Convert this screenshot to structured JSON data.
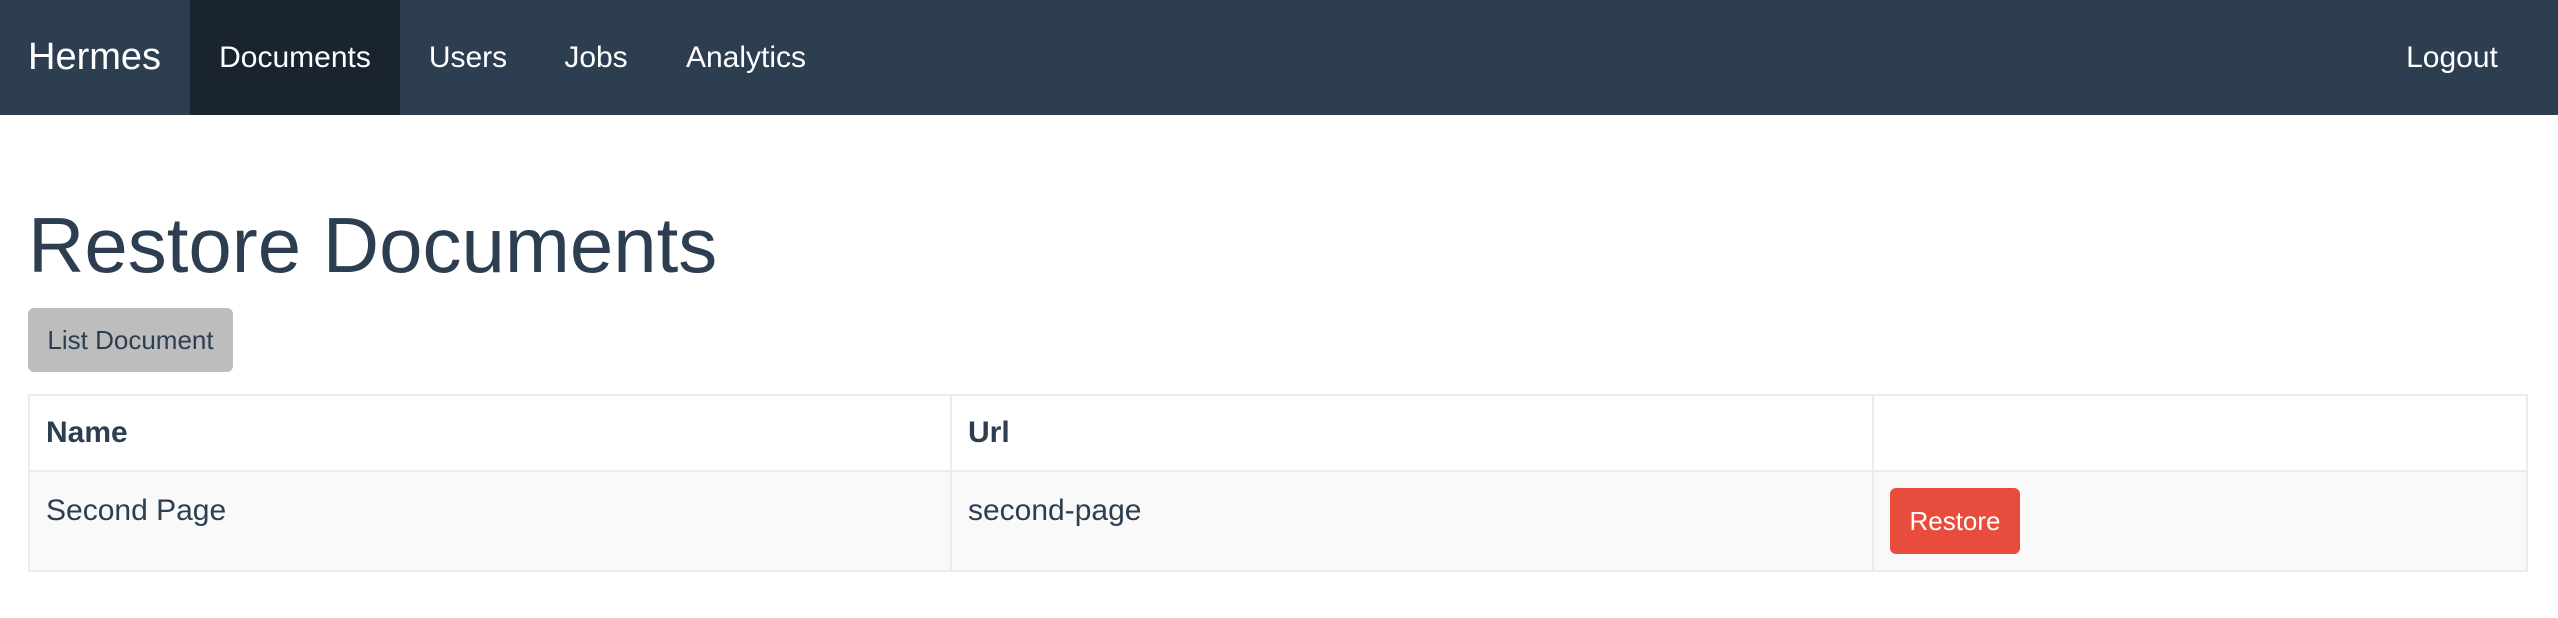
{
  "navbar": {
    "brand": "Hermes",
    "items": [
      {
        "label": "Documents",
        "active": true
      },
      {
        "label": "Users",
        "active": false
      },
      {
        "label": "Jobs",
        "active": false
      },
      {
        "label": "Analytics",
        "active": false
      }
    ],
    "logout": "Logout"
  },
  "page": {
    "title": "Restore Documents",
    "list_button": "List Document"
  },
  "table": {
    "headers": [
      "Name",
      "Url",
      ""
    ],
    "rows": [
      {
        "name": "Second Page",
        "url": "second-page",
        "action": "Restore"
      }
    ]
  },
  "colors": {
    "navbar_bg": "#2c3e50",
    "active_nav_bg": "#1a242f",
    "danger": "#e74c3c",
    "default_button": "#bdbdbd"
  }
}
